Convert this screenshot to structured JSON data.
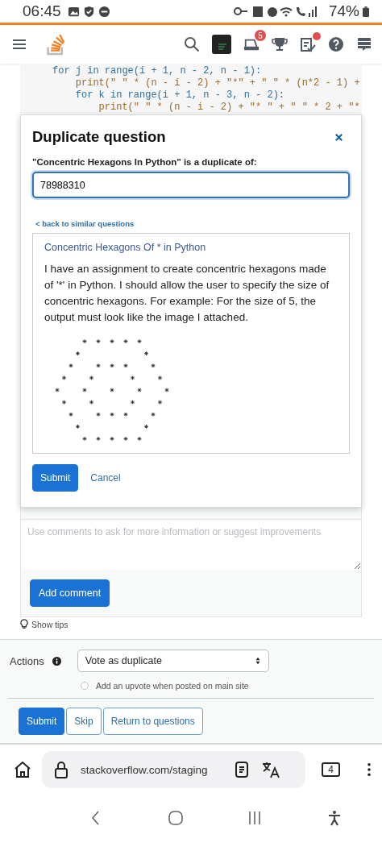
{
  "status_bar": {
    "time": "06:45",
    "battery": "74%"
  },
  "header": {
    "inbox_count": "5"
  },
  "code_lines": [
    "for j in range(i + 1, n - 2, n - 1):",
    "    print(\" \" * (n - i - 2) + \"*\" + \" \" * (n*2 - 1) +",
    "    for k in range(i + 1, n - 3, n - 2):",
    "        print(\" \" * (n - i - 2) + \"* \" + \" \" * 2 + \"*"
  ],
  "comment_box": {
    "placeholder": "Use comments to ask for more information or suggest improvements",
    "button": "Add comment"
  },
  "tips_link": "Show tips",
  "actions": {
    "label": "Actions",
    "select_value": "Vote as duplicate",
    "upvote_option": {
      "label": "Add an upvote when posted on main site",
      "checked": false
    }
  },
  "buttons": [
    {
      "label": "Submit",
      "kind": "primary"
    },
    {
      "label": "Skip",
      "kind": "outline"
    },
    {
      "label": "Return to questions",
      "kind": "outline"
    }
  ],
  "browser": {
    "url": "stackoverflow.com/staging",
    "tab_count": "4"
  },
  "modal": {
    "title": "Duplicate question",
    "label": "\"Concentric Hexagons In Python\" is a duplicate of:",
    "input_value": "78988310",
    "back_link": "< back to similar questions",
    "result": {
      "title": "Concentric Hexagons Of * in Python",
      "body": "I have an assignment to create concentric hexagons made of '*' in Python. I should allow the user to specify the size of concentric hexagons. For example: For the size of 5, the output must look like the image I attached."
    },
    "buttons": [
      {
        "label": "Submit",
        "kind": "primary"
      },
      {
        "label": "Cancel",
        "kind": "link"
      }
    ]
  }
}
